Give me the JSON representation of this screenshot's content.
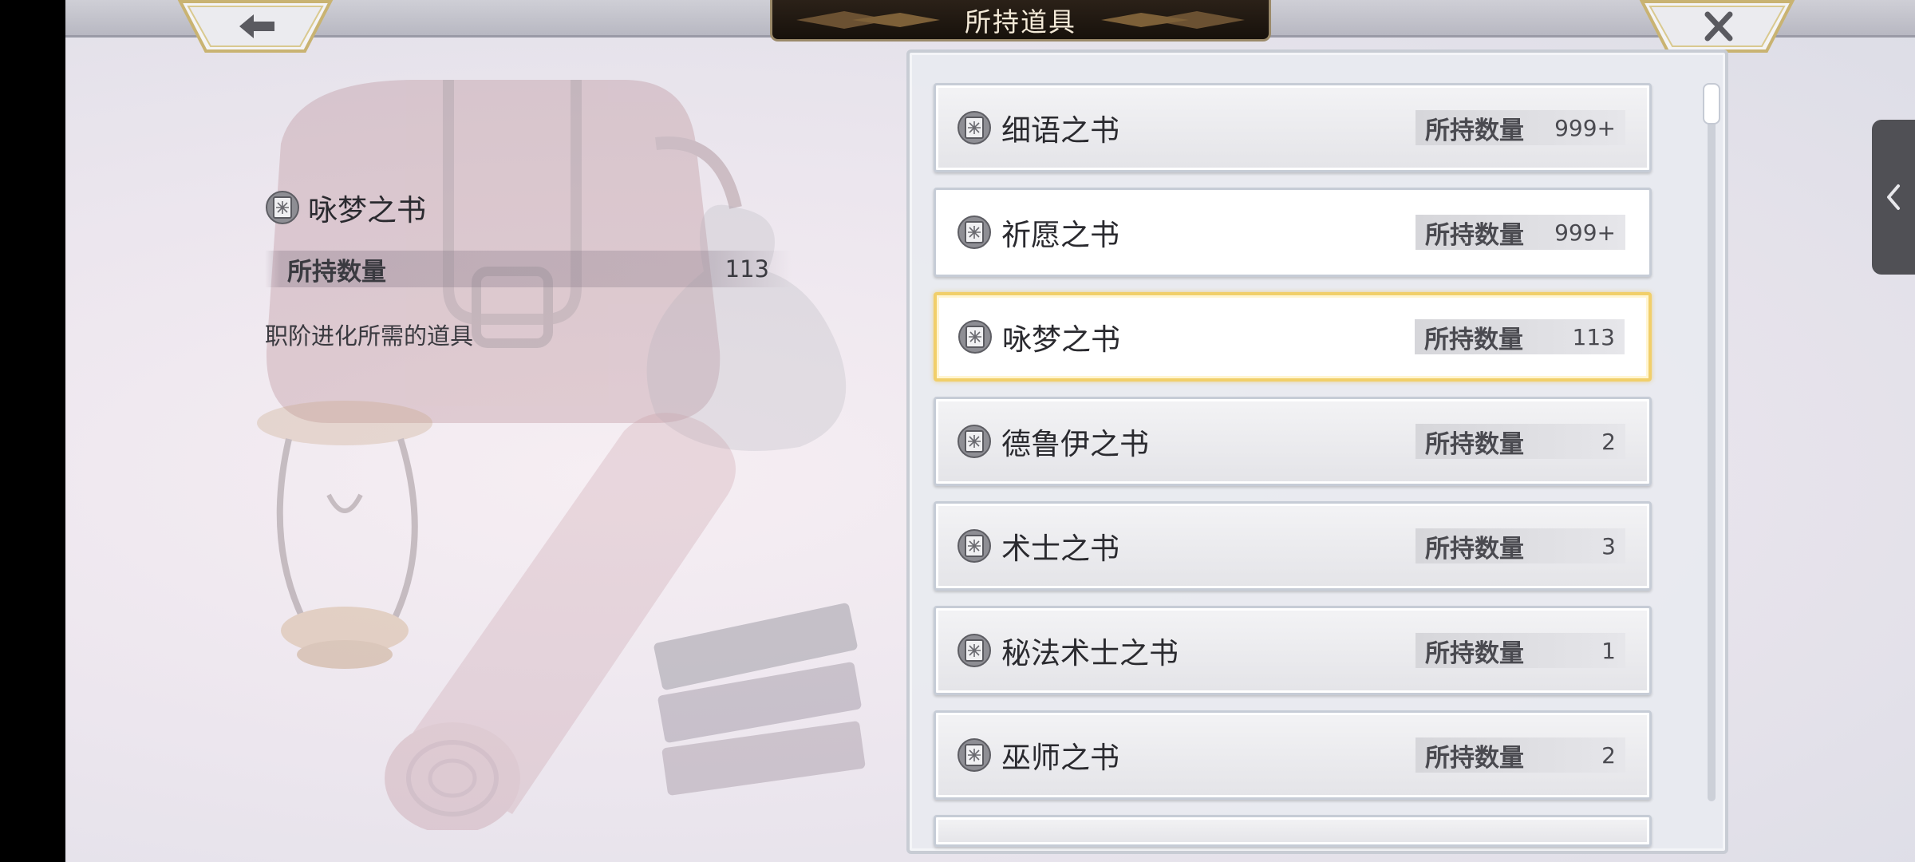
{
  "header": {
    "title": "所持道具",
    "back_icon": "arrow-left-icon",
    "close_icon": "close-icon"
  },
  "detail": {
    "name": "咏梦之书",
    "icon": "book-icon",
    "qty_label": "所持数量",
    "qty_value": "113",
    "description": "职阶进化所需的道具"
  },
  "items": [
    {
      "name": "细语之书",
      "qty_label": "所持数量",
      "qty": "999+"
    },
    {
      "name": "祈愿之书",
      "qty_label": "所持数量",
      "qty": "999+"
    },
    {
      "name": "咏梦之书",
      "qty_label": "所持数量",
      "qty": "113"
    },
    {
      "name": "德鲁伊之书",
      "qty_label": "所持数量",
      "qty": "2"
    },
    {
      "name": "术士之书",
      "qty_label": "所持数量",
      "qty": "3"
    },
    {
      "name": "秘法术士之书",
      "qty_label": "所持数量",
      "qty": "1"
    },
    {
      "name": "巫师之书",
      "qty_label": "所持数量",
      "qty": "2"
    }
  ],
  "selected_index": 2,
  "side_tab_icon": "chevron-left-icon",
  "colors": {
    "selected_border": "#f1cf6a",
    "title_plate": "#1f1710"
  }
}
